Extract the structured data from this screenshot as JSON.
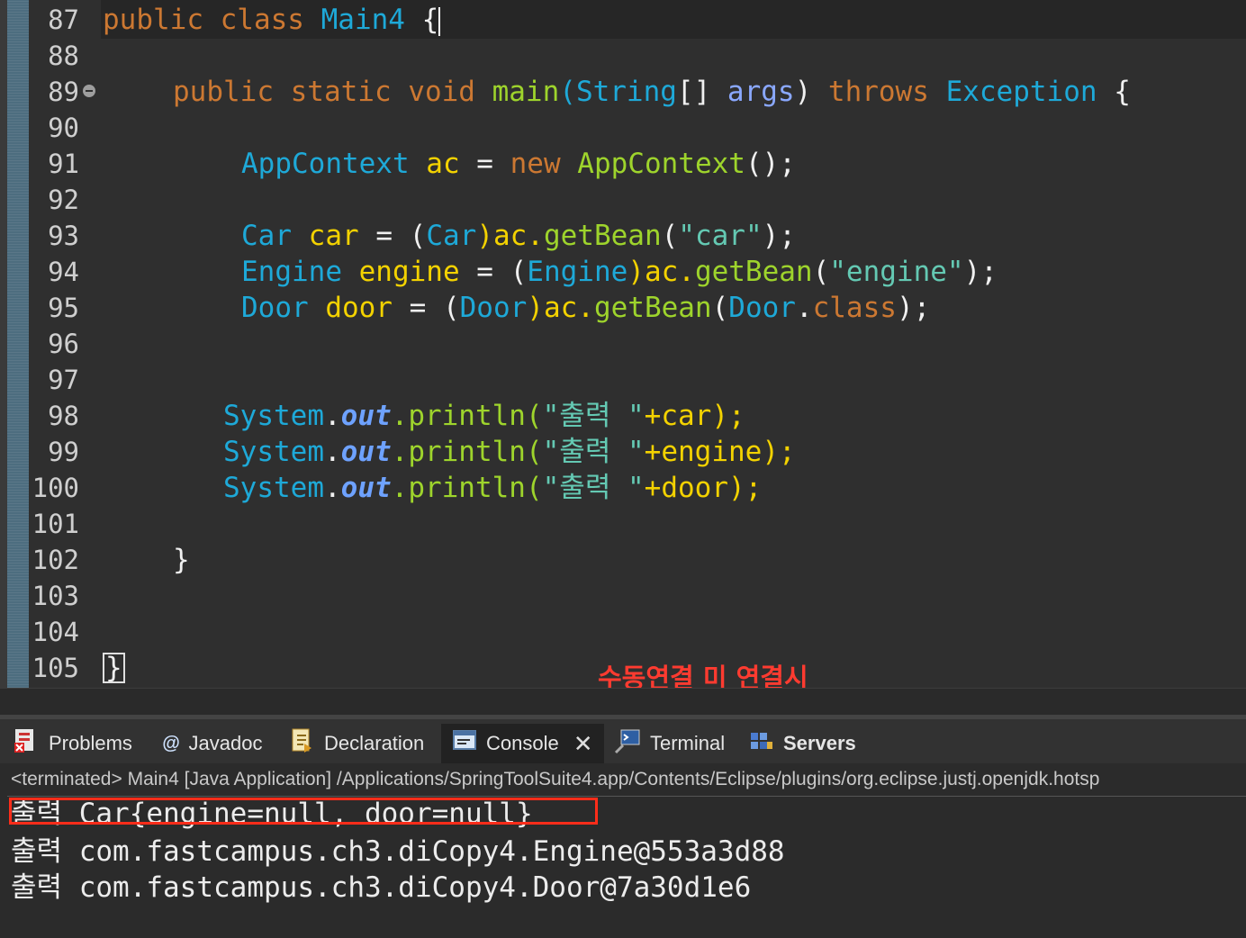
{
  "editor": {
    "line_numbers": [
      "87",
      "88",
      "89",
      "90",
      "91",
      "92",
      "93",
      "94",
      "95",
      "96",
      "97",
      "98",
      "99",
      "100",
      "101",
      "102",
      "103",
      "104",
      "105"
    ],
    "fold_marker_line": "89",
    "lines": {
      "l87": [
        "public class ",
        "Main4",
        " {"
      ],
      "l89": [
        "public static void ",
        "main",
        "(",
        "String",
        "[] ",
        "args",
        ") ",
        "throws ",
        "Exception",
        " {"
      ],
      "l91": [
        "AppContext",
        " ac",
        " = ",
        "new ",
        "AppContext",
        "();"
      ],
      "l93": [
        "Car",
        " car",
        " = (",
        "Car",
        ")ac.",
        "getBean",
        "(",
        "\"car\"",
        ");"
      ],
      "l94": [
        "Engine",
        " engine",
        " = (",
        "Engine",
        ")ac.",
        "getBean",
        "(",
        "\"engine\"",
        ");"
      ],
      "l95": [
        "Door",
        " door",
        " = (",
        "Door",
        ")ac.",
        "getBean",
        "(",
        "Door",
        ".",
        "class",
        ");"
      ],
      "l98": [
        "System",
        ".",
        "out",
        ".println(",
        "\"출력 \"",
        "+car);"
      ],
      "l99": [
        "System",
        ".",
        "out",
        ".println(",
        "\"출력 \"",
        "+engine);"
      ],
      "l100": [
        "System",
        ".",
        "out",
        ".println(",
        "\"출력 \"",
        "+door);"
      ],
      "l102": "}",
      "l105": "}"
    },
    "annotation": "수동연결 미 연결시"
  },
  "panel": {
    "tabs": [
      {
        "label": "Problems",
        "icon": "problems-icon"
      },
      {
        "label": "Javadoc",
        "icon": "javadoc-icon"
      },
      {
        "label": "Declaration",
        "icon": "declaration-icon"
      },
      {
        "label": "Console",
        "icon": "console-icon",
        "active": true
      },
      {
        "label": "Terminal",
        "icon": "terminal-icon"
      },
      {
        "label": "Servers",
        "icon": "servers-icon"
      }
    ],
    "status": "<terminated> Main4 [Java Application] /Applications/SpringToolSuite4.app/Contents/Eclipse/plugins/org.eclipse.justj.openjdk.hotsp",
    "output": [
      "출력 Car{engine=null, door=null}",
      "출력 com.fastcampus.ch3.diCopy4.Engine@553a3d88",
      "출력 com.fastcampus.ch3.diCopy4.Door@7a30d1e6"
    ]
  },
  "colors": {
    "keyword": "#cc7832",
    "class": "#1ea9d8",
    "variable": "#f3d200",
    "method": "#9ed42c",
    "string": "#64c9b3",
    "highlight_box": "#ff2d1a"
  }
}
